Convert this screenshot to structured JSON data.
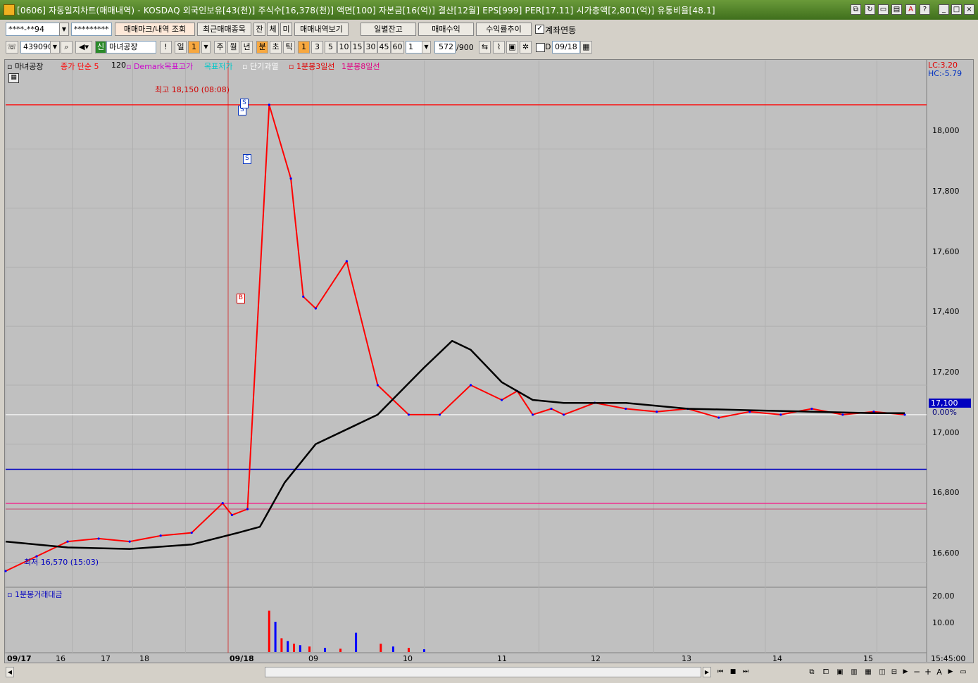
{
  "window": {
    "title": "[0606] 자동일지차트(매매내역) - KOSDAQ 외국인보유[43(천)] 주식수[16,378(천)] 액면[100] 자본금[16(억)] 결산[12월] EPS[999] PER[17.11] 시가총액[2,801(억)] 유통비율[48.1]"
  },
  "toolbar1": {
    "account_value": "****-**94",
    "password_value": "*********",
    "buttons": [
      "매매마크/내역 조회",
      "최근매매종목",
      "잔",
      "체",
      "미",
      "매매내역보기"
    ],
    "right_buttons": [
      "일별잔고",
      "매매수익",
      "수익률추이"
    ],
    "checkbox_label": "계좌연동"
  },
  "toolbar2": {
    "code": "439090",
    "new_badge": "신",
    "stock_name": "마녀공장",
    "excl": "!",
    "period_day": "일",
    "period_num": "1",
    "periods": [
      "주",
      "월",
      "년",
      "분",
      "초",
      "틱"
    ],
    "minute_opts": [
      "1",
      "3",
      "5",
      "10",
      "15",
      "30",
      "45",
      "60"
    ],
    "count_value": "1",
    "view_count": "572",
    "view_total": "/900",
    "d_label": "D",
    "date_value": "09/18"
  },
  "legend": {
    "items": [
      "마녀공장",
      "종가 단순 5",
      "120",
      "Demark목표고가",
      "목표저가",
      "단기과열",
      "1분봉3일선",
      "1분봉8일선"
    ],
    "lc": "LC:3.20",
    "hc": "HC:-5.79"
  },
  "annotations": {
    "high": "최고 18,150 (08:08)",
    "low": "최저 16,570 (15:03)",
    "current_price": "17,100",
    "current_pct": "0.00%",
    "buy_marker": "B",
    "sell_marker": "S"
  },
  "volume_panel": {
    "label": "1분봉거래대금",
    "y_ticks": [
      "20.00",
      "10.00"
    ]
  },
  "time_label": "15:45:00",
  "colors": {
    "title_green": "#4f7f2a",
    "chart_bg": "#c0c0c0",
    "price_up": "#ff0000",
    "price_down": "#0000ff",
    "ma_line": "#000000",
    "demark_high": "#ff0080",
    "blue_level": "#0000c0"
  },
  "chart_data": {
    "type": "line",
    "title": "",
    "xlabel": "",
    "ylabel": "",
    "y_ticks": [
      18000,
      17800,
      17600,
      17400,
      17200,
      17000,
      16800,
      16600
    ],
    "ylim": [
      16520,
      18300
    ],
    "x_ticks": [
      "09/17",
      "16",
      "17",
      "18",
      "09/18",
      "09",
      "10",
      "11",
      "12",
      "13",
      "14",
      "15"
    ],
    "horizontal_lines": [
      {
        "name": "high",
        "value": 18150,
        "color": "#ff0000"
      },
      {
        "name": "current",
        "value": 17100,
        "color": "#ffffff"
      },
      {
        "name": "blue-level",
        "value": 16915,
        "color": "#0000c0"
      },
      {
        "name": "demark-high",
        "value": 16800,
        "color": "#ff0080"
      },
      {
        "name": "low-target",
        "value": 16780,
        "color": "#c06080"
      }
    ],
    "series": [
      {
        "name": "price",
        "x": [
          0,
          1,
          2,
          3,
          4,
          5,
          6,
          7,
          7.3,
          7.8,
          8.5,
          9.2,
          9.6,
          10,
          11,
          12,
          13,
          14,
          15,
          16,
          16.5,
          17,
          17.6,
          18,
          19,
          20,
          21,
          22,
          23,
          24,
          25,
          26,
          27,
          28,
          29
        ],
        "values": [
          16570,
          16620,
          16670,
          16680,
          16670,
          16690,
          16700,
          16800,
          16760,
          16780,
          18150,
          17900,
          17500,
          17460,
          17620,
          17200,
          17100,
          17100,
          17200,
          17150,
          17180,
          17100,
          17120,
          17100,
          17140,
          17120,
          17110,
          17120,
          17090,
          17110,
          17100,
          17120,
          17100,
          17110,
          17100
        ]
      },
      {
        "name": "120",
        "x": [
          0,
          2,
          4,
          6,
          7.5,
          8.2,
          9,
          10,
          12,
          13.5,
          14.4,
          15,
          16,
          17,
          18,
          19,
          20,
          22,
          24,
          26,
          28,
          29
        ],
        "values": [
          16670,
          16650,
          16645,
          16660,
          16700,
          16720,
          16870,
          17000,
          17100,
          17260,
          17350,
          17320,
          17210,
          17150,
          17140,
          17140,
          17140,
          17120,
          17115,
          17110,
          17105,
          17105
        ]
      }
    ],
    "volume": {
      "name": "1분봉거래대금",
      "ylim": [
        0,
        22
      ],
      "x": [
        8.5,
        8.7,
        8.9,
        9.1,
        9.3,
        9.5,
        9.8,
        10.3,
        10.8,
        11.3,
        12.1,
        12.5,
        13,
        13.5
      ],
      "values": [
        15,
        11,
        5,
        4,
        3,
        2.5,
        2,
        1.5,
        1.2,
        7,
        3,
        2,
        1.5,
        1
      ]
    },
    "grid": true,
    "legend": "top-left"
  }
}
